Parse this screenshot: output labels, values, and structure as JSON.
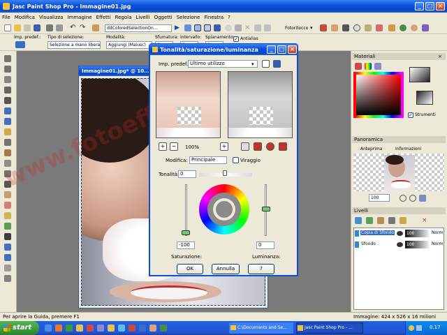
{
  "app": {
    "title": "Jasc Paint Shop Pro - Immagine01.jpg",
    "menu": [
      "File",
      "Modifica",
      "Visualizza",
      "Immagine",
      "Effetti",
      "Regola",
      "Livelli",
      "Oggetti",
      "Selezione",
      "Finestra",
      "?"
    ],
    "toolbar_preset": "ddColoredSelectionOn...",
    "toolbar_photo": "Fotoritocco"
  },
  "options": {
    "preset_label": "Imp. predef.:",
    "selection_type_label": "Tipo di selezione:",
    "selection_type_value": "Selezione a mano libera",
    "mode_label": "Modalità:",
    "mode_value": "Aggiungi (Maiusc)",
    "feather_label": "Sfumatura:",
    "feather_value": "0",
    "interval_label": "Intervallo:",
    "interval_value": "0",
    "smoothing_label": "Spianamento:",
    "smoothing_value": "0",
    "antialias_label": "Antialias"
  },
  "image_window": {
    "title": "Immagine01.jpg* @ 10..."
  },
  "watermark": "www.fotoeffetti.it",
  "dialog": {
    "title": "Tonalità/saturazione/luminanza",
    "preset_label": "Imp. predef.:",
    "preset_value": "Ultimo utilizzo",
    "zoom": "100%",
    "modify_label": "Modifica:",
    "modify_value": "Principale",
    "colorize_label": "Viraggio",
    "hue_label": "Tonalità:",
    "hue_value": "0",
    "saturation_label": "Saturazione:",
    "saturation_value": "-100",
    "lightness_label": "Luminanza:",
    "lightness_value": "0",
    "ok": "OK",
    "cancel": "Annulla",
    "help": "?"
  },
  "materials": {
    "title": "Materiali",
    "tools_label": "Strumenti"
  },
  "overview": {
    "title": "Panoramica",
    "tab_preview": "Anteprima",
    "tab_info": "Informazioni",
    "zoom": "100"
  },
  "layers": {
    "title": "Livelli",
    "items": [
      {
        "name": "Copia di Sfondo",
        "opacity": "100",
        "blend": "Norm"
      },
      {
        "name": "Sfondo",
        "opacity": "100",
        "blend": "Norm"
      }
    ]
  },
  "status": {
    "left": "Per aprire la Guida, premere F1",
    "right": "Immagine: 424 x 526 x 16 milioni"
  },
  "taskbar": {
    "start": "start",
    "tasks": [
      "C:\\Documents and Se...",
      "Jasc Paint Shop Pro - ..."
    ],
    "clock": "0.17"
  },
  "colors": {
    "xp_blue": "#0a4fd6",
    "face": "#ece9d8",
    "start_green": "#3c9b3c"
  }
}
